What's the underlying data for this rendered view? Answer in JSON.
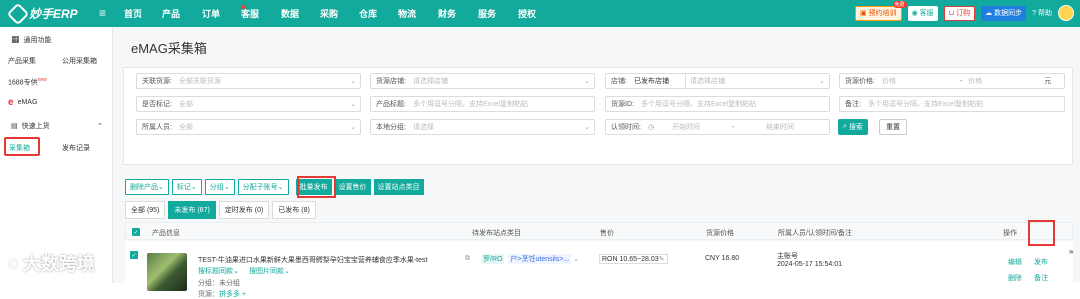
{
  "topbar": {
    "logo": "妙手ERP",
    "nav": [
      "首页",
      "产品",
      "订单",
      "客服",
      "数据",
      "采购",
      "仓库",
      "物流",
      "财务",
      "服务",
      "授权"
    ],
    "train": "预约培训",
    "train_badge": "免费",
    "service": "客服",
    "order": "订购",
    "sync": "数据同步",
    "help": "帮助"
  },
  "sidebar": {
    "general": "通用功能",
    "product_collect": "产品采集",
    "public_box": "公用采集箱",
    "p1688": "1688专供",
    "p1688_badge": "new",
    "emag": "eMAG",
    "quick_upload": "快速上货",
    "collect_box": "采集箱",
    "publish_log": "发布记录"
  },
  "page": {
    "title": "eMAG采集箱"
  },
  "filters": {
    "source_label": "关联货源:",
    "source_ph": "全部关联货源",
    "shop_label": "货源店铺:",
    "shop_ph": "请选择店铺",
    "store_label": "店铺:",
    "store_val": "已发布店铺",
    "store_ph": "请选择店铺",
    "price_label": "货源价格:",
    "price_min": "价格",
    "price_max": "价格",
    "price_unit": "元",
    "marked_label": "是否标记:",
    "marked_ph": "全部",
    "title_label": "产品标题:",
    "title_ph": "多个用逗号分隔，支持Excel复制粘贴",
    "id_label": "货源ID:",
    "id_ph": "多个用逗号分隔，支持Excel复制粘贴",
    "note_label": "备注:",
    "note_ph": "多个用逗号分隔，支持Excel复制粘贴",
    "owner_label": "所属人员:",
    "owner_ph": "全部",
    "group_label": "本地分组:",
    "group_ph": "请选择",
    "claim_label": "认领时间:",
    "start_ph": "开始时间",
    "end_ph": "结束时间",
    "search": "搜索",
    "reset": "重置"
  },
  "toolbar": [
    "删除产品",
    "标记",
    "分组",
    "分配子账号"
  ],
  "toolbar_fill": [
    "批量发布",
    "设置售价",
    "设置站点类目"
  ],
  "tabs": [
    "全部 (95)",
    "未发布 (87)",
    "定时发布 (0)",
    "已发布 (8)"
  ],
  "table": {
    "headers": [
      "产品信息",
      "待发布站点类目",
      "售价",
      "货源价格",
      "所属人员/认领时间/备注",
      "操作"
    ],
    "row": {
      "title": "TEST-牛油果进口水果新鲜大果墨西哥鳄梨孕妇宝宝营养辅食应季水果-test",
      "search_similar": "搜标题同款",
      "search_image": "搜图片同款",
      "group": "分组：未分组",
      "source": "货源：",
      "source_val": "拼多多",
      "site_tag": "罗/RO",
      "category_tag": "户>烹饪utensils>...",
      "price": "RON  10.65~28.03",
      "cost": "CNY 16.80",
      "owner": "主账号",
      "time": "2024-05-17 15:54:01",
      "edit": "编辑",
      "publish": "发布",
      "delete": "删除",
      "note": "备注"
    }
  },
  "watermark": "大数跨境",
  "colors": {
    "brand": "#12aa9c",
    "highlight": "#e53935"
  }
}
